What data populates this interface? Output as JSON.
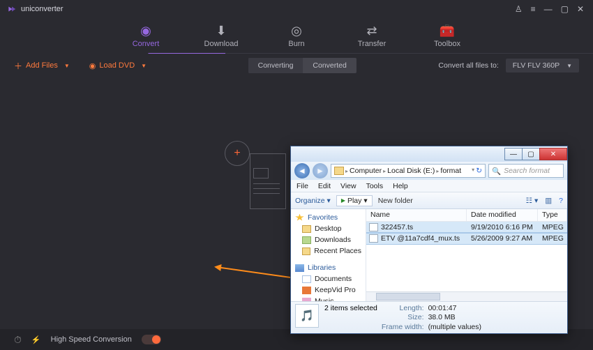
{
  "app": {
    "name": "uniconverter"
  },
  "nav": {
    "items": [
      {
        "label": "Convert",
        "icon": "convert-icon"
      },
      {
        "label": "Download",
        "icon": "download-icon"
      },
      {
        "label": "Burn",
        "icon": "burn-icon"
      },
      {
        "label": "Transfer",
        "icon": "transfer-icon"
      },
      {
        "label": "Toolbox",
        "icon": "toolbox-icon"
      }
    ],
    "active_index": 0
  },
  "toolbar": {
    "add_files": "Add Files",
    "load_dvd": "Load DVD",
    "seg_converting": "Converting",
    "seg_converted": "Converted",
    "convert_all_label": "Convert all files to:",
    "format_selected": "FLV FLV 360P"
  },
  "footer": {
    "hsc_label": "High Speed Conversion",
    "hsc_on": true
  },
  "explorer": {
    "breadcrumb": [
      "Computer",
      "Local Disk (E:)",
      "format"
    ],
    "search_placeholder": "Search format",
    "menu": [
      "File",
      "Edit",
      "View",
      "Tools",
      "Help"
    ],
    "tool_organize": "Organize",
    "tool_play": "Play",
    "tool_newfolder": "New folder",
    "nav": {
      "favorites": "Favorites",
      "favorites_items": [
        "Desktop",
        "Downloads",
        "Recent Places"
      ],
      "libraries": "Libraries",
      "libraries_items": [
        "Documents",
        "KeepVid Pro",
        "Music"
      ]
    },
    "columns": {
      "name": "Name",
      "date": "Date modified",
      "type": "Type"
    },
    "rows": [
      {
        "name": "322457.ts",
        "date": "9/19/2010 6:16 PM",
        "type": "MPEG",
        "selected": true
      },
      {
        "name": "ETV @11a7cdf4_mux.ts",
        "date": "5/26/2009 9:27 AM",
        "type": "MPEG",
        "selected": true
      }
    ],
    "status": {
      "summary": "2 items selected",
      "length_label": "Length:",
      "length": "00:01:47",
      "size_label": "Size:",
      "size": "38.0 MB",
      "fw_label": "Frame width:",
      "fw": "(multiple values)"
    }
  }
}
